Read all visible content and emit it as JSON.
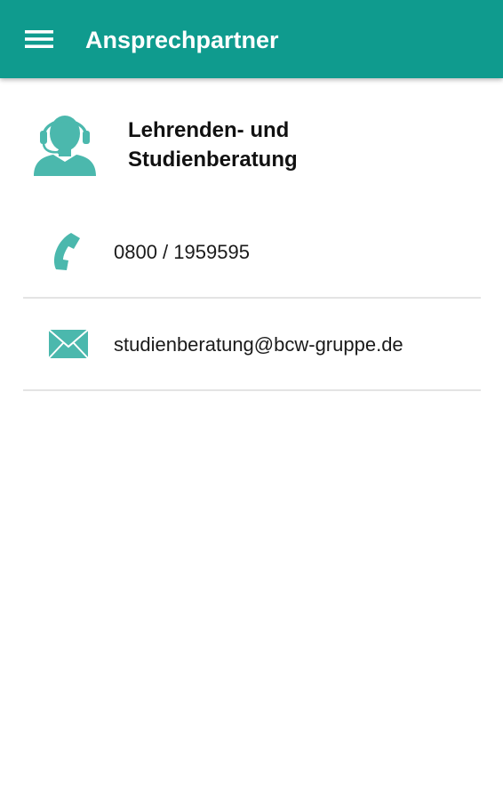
{
  "appbar": {
    "title": "Ansprechpartner",
    "menu_icon": "hamburger-menu-icon",
    "color": "#0f9b8e"
  },
  "contact": {
    "avatar_icon": "headset-support-person-icon",
    "name_line1": "Lehrenden- und",
    "name_line2": "Studienberatung",
    "accent_color": "#4bb8ad"
  },
  "details": {
    "phone": {
      "icon": "phone-icon",
      "value": "0800 / 1959595"
    },
    "email": {
      "icon": "envelope-icon",
      "value": "studienberatung@bcw-gruppe.de"
    }
  }
}
